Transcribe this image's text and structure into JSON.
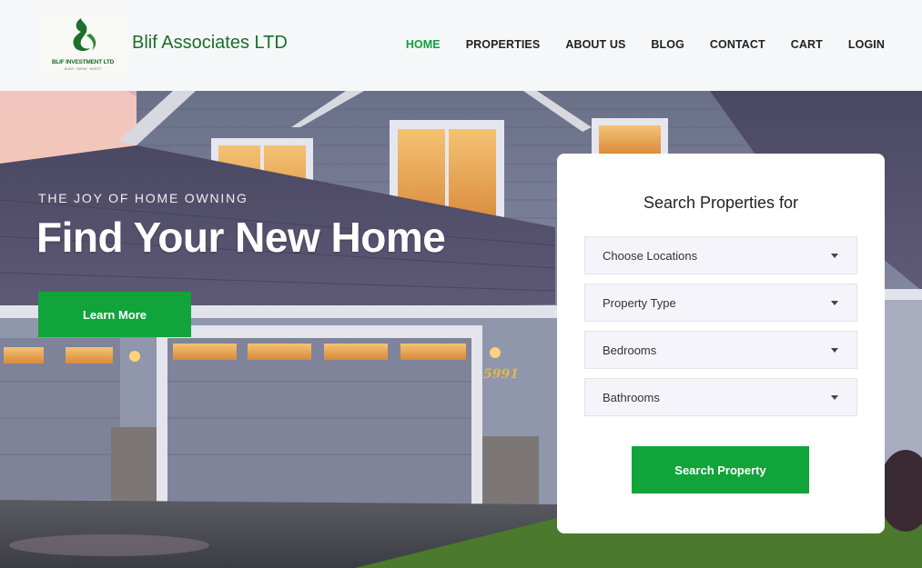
{
  "header": {
    "logo_text": "BLIF INVESTMENT LTD",
    "logo_subtext": "BUILD · GROW · INVEST",
    "brand": "Blif Associates LTD",
    "nav": [
      {
        "label": "HOME",
        "active": true
      },
      {
        "label": "PROPERTIES",
        "active": false
      },
      {
        "label": "ABOUT US",
        "active": false
      },
      {
        "label": "BLOG",
        "active": false
      },
      {
        "label": "CONTACT",
        "active": false
      },
      {
        "label": "CART",
        "active": false
      },
      {
        "label": "LOGIN",
        "active": false
      }
    ]
  },
  "hero": {
    "tagline": "THE JOY OF HOME OWNING",
    "headline": "Find Your New Home",
    "cta_label": "Learn More",
    "house_number": "5991"
  },
  "search": {
    "title": "Search Properties for",
    "fields": [
      {
        "label": "Choose Locations"
      },
      {
        "label": "Property Type"
      },
      {
        "label": "Bedrooms"
      },
      {
        "label": "Bathrooms"
      }
    ],
    "button_label": "Search Property"
  },
  "colors": {
    "accent_green": "#10a43a",
    "brand_green": "#1a6f2a",
    "nav_active": "#0ea33a"
  }
}
